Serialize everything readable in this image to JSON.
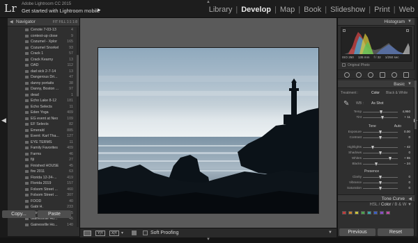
{
  "app": {
    "logo": "Lr",
    "version": "Adobe Lightroom CC 2015",
    "get_started": "Get started with Lightroom mobile"
  },
  "modules": [
    {
      "label": "Library",
      "active": false
    },
    {
      "label": "Develop",
      "active": true
    },
    {
      "label": "Map",
      "active": false
    },
    {
      "label": "Book",
      "active": false
    },
    {
      "label": "Slideshow",
      "active": false
    },
    {
      "label": "Print",
      "active": false
    },
    {
      "label": "Web",
      "active": false
    }
  ],
  "navigator": {
    "title": "Navigator",
    "options": "FIT  FILL  1:1  1:8"
  },
  "folders": [
    {
      "name": "Cenote 7-03-13",
      "count": "4"
    },
    {
      "name": "contest-up close",
      "count": "9"
    },
    {
      "name": "Cozumel - Xplor",
      "count": "165"
    },
    {
      "name": "Cozumel Snorkel",
      "count": "93"
    },
    {
      "name": "Crack 1",
      "count": "57"
    },
    {
      "name": "Crack Kearny",
      "count": "13"
    },
    {
      "name": "OAD",
      "count": "112"
    },
    {
      "name": "dad sick 2-7-14",
      "count": "13"
    },
    {
      "name": "Dangerous Dri...",
      "count": "47"
    },
    {
      "name": "danny portaits",
      "count": "38"
    },
    {
      "name": "Danny, Boston ...",
      "count": "97"
    },
    {
      "name": "dead",
      "count": "1"
    },
    {
      "name": "Echo Lake 8-12",
      "count": "181"
    },
    {
      "name": "Echo Selects",
      "count": "11"
    },
    {
      "name": "Eden Yoga",
      "count": "409"
    },
    {
      "name": "EG event at Neo",
      "count": "109"
    },
    {
      "name": "EF Selects",
      "count": "82"
    },
    {
      "name": "Emerald",
      "count": "885"
    },
    {
      "name": "Event: Karl Tha...",
      "count": "127"
    },
    {
      "name": "EYE TERMS",
      "count": "11"
    },
    {
      "name": "Family Favorites",
      "count": "409"
    },
    {
      "name": "Farms",
      "count": "46"
    },
    {
      "name": "fiji",
      "count": "27"
    },
    {
      "name": "Finished HOUSE",
      "count": "45"
    },
    {
      "name": "fire 2011",
      "count": "63"
    },
    {
      "name": "Florida 12-24-...",
      "count": "419"
    },
    {
      "name": "Florida 2019",
      "count": "157"
    },
    {
      "name": "Folsom Street ...",
      "count": "460"
    },
    {
      "name": "Folsom Street ...",
      "count": "307"
    },
    {
      "name": "FOOD",
      "count": "40"
    },
    {
      "name": "Gabi H.",
      "count": "233"
    },
    {
      "name": "Gainesville Ho...",
      "count": "45"
    },
    {
      "name": "Gainesville Ho...",
      "count": "45"
    },
    {
      "name": "Gainesville Ho...",
      "count": "140"
    }
  ],
  "left_buttons": {
    "copy": "Copy...",
    "paste": "Paste"
  },
  "histogram": {
    "title": "Histogram",
    "iso": "ISO 250",
    "focal": "135 mm",
    "aperture": "f / 32",
    "shutter": "1/250 sec",
    "original_photo": "Original Photo"
  },
  "basic": {
    "title": "Basic",
    "treatment_label": "Treatment :",
    "treatment_color": "Color",
    "treatment_bw": "Black & White",
    "wb_label": "WB :",
    "wb_value": "As Shot",
    "temp": {
      "label": "Temp",
      "value": "4,950",
      "pos": 0.52
    },
    "tint": {
      "label": "Tint",
      "value": "+ 11",
      "pos": 0.56
    },
    "tone_label": "Tone",
    "auto_label": "Auto",
    "exposure": {
      "label": "Exposure",
      "value": "0.00",
      "pos": 0.5
    },
    "contrast": {
      "label": "Contrast",
      "value": "0",
      "pos": 0.5
    },
    "highlights": {
      "label": "Highlights",
      "value": "− 42",
      "pos": 0.29
    },
    "shadows": {
      "label": "Shadows",
      "value": "0",
      "pos": 0.5
    },
    "whites": {
      "label": "Whites",
      "value": "+ 55",
      "pos": 0.78
    },
    "blacks": {
      "label": "Blacks",
      "value": "− 24",
      "pos": 0.38
    },
    "presence_label": "Presence",
    "clarity": {
      "label": "Clarity",
      "value": "0",
      "pos": 0.5
    },
    "vibrance": {
      "label": "Vibrance",
      "value": "0",
      "pos": 0.5
    },
    "saturation": {
      "label": "Saturation",
      "value": "0",
      "pos": 0.5
    }
  },
  "panels": {
    "tone_curve": "Tone Curve",
    "hsl": "HSL",
    "color": "Color",
    "bw": "B & W"
  },
  "toolbar": {
    "yy": "Y|Y",
    "xy": "X|Y",
    "soft_proofing": "Soft Proofing"
  },
  "right_buttons": {
    "previous": "Previous",
    "reset": "Reset"
  },
  "swatch_colors": [
    "#c23a3a",
    "#c9822e",
    "#c8c23a",
    "#4ca24c",
    "#3aa6a6",
    "#3a5ec6",
    "#8a4ac6",
    "#c24aa6"
  ]
}
